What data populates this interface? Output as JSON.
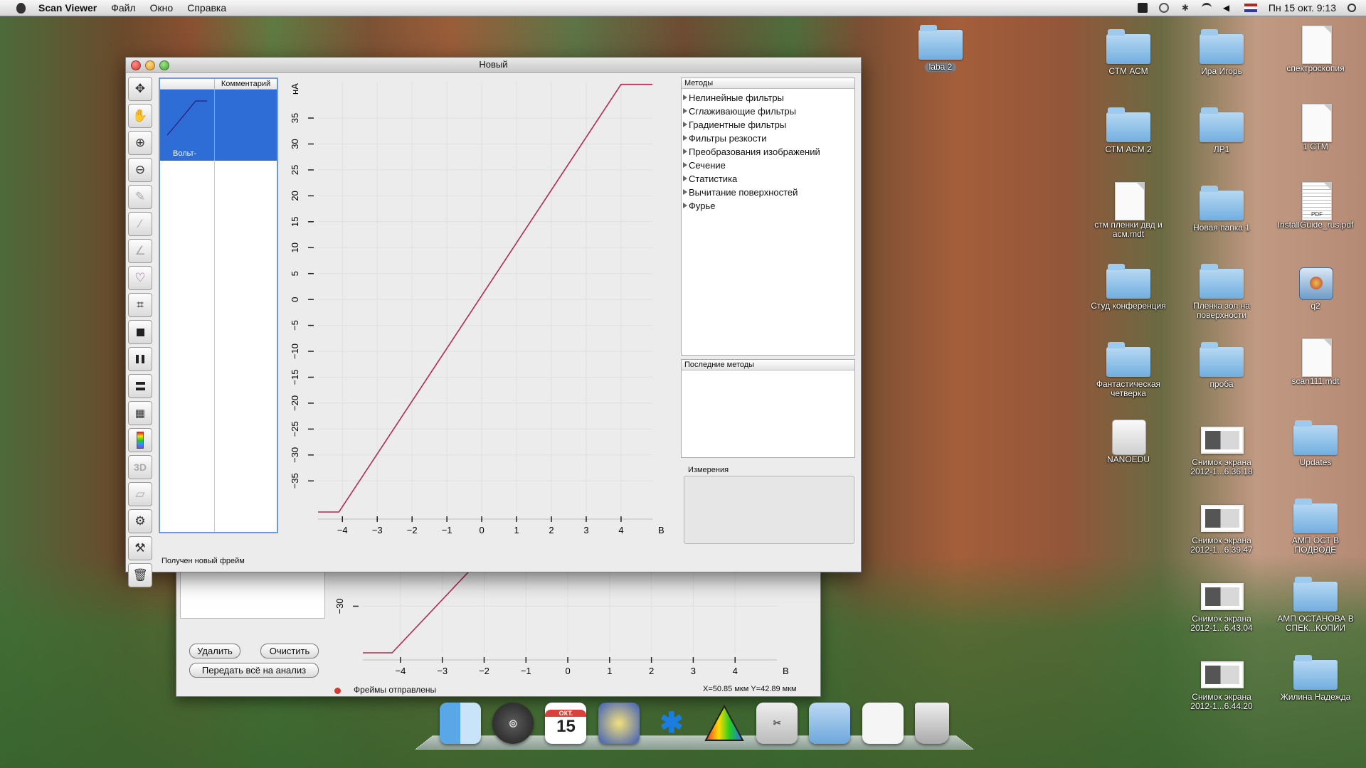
{
  "menubar": {
    "app_name": "Scan Viewer",
    "menus": [
      "Файл",
      "Окно",
      "Справка"
    ],
    "clock": "Пн 15 окт.  9:13"
  },
  "desktop": {
    "icons": [
      {
        "label": "laba 2",
        "kind": "folder"
      },
      {
        "label": "СТМ АСМ",
        "kind": "folder"
      },
      {
        "label": "Ира Игорь",
        "kind": "folder"
      },
      {
        "label": "спектроскопия",
        "kind": "doc"
      },
      {
        "label": "СТМ АСМ  2",
        "kind": "folder"
      },
      {
        "label": "ЛР1",
        "kind": "folder"
      },
      {
        "label": "1 СТМ",
        "kind": "doc"
      },
      {
        "label": "стм пленки двд и асм.mdt",
        "kind": "doc"
      },
      {
        "label": "Новая папка 1",
        "kind": "folder"
      },
      {
        "label": "InstallGuide_rus.pdf",
        "kind": "pdf"
      },
      {
        "label": "Студ конференция",
        "kind": "folder"
      },
      {
        "label": "Пленка зол на поверхности",
        "kind": "folder"
      },
      {
        "label": "q2",
        "kind": "app"
      },
      {
        "label": "Фантастическая четверка",
        "kind": "folder"
      },
      {
        "label": "проба",
        "kind": "folder"
      },
      {
        "label": "scan111.mdt",
        "kind": "doc"
      },
      {
        "label": "NANOEDU",
        "kind": "drive"
      },
      {
        "label": "Снимок экрана 2012-1...6.36.18",
        "kind": "shot"
      },
      {
        "label": "Updates",
        "kind": "folder"
      },
      {
        "label": "Снимок экрана 2012-1...6.39.47",
        "kind": "shot"
      },
      {
        "label": "АМП ОСТ В ПОДВОДЕ",
        "kind": "folder"
      },
      {
        "label": "Снимок экрана 2012-1...6.43.04",
        "kind": "shot"
      },
      {
        "label": "АМП ОСТАНОВА В СПЕК...КОПИИ",
        "kind": "folder"
      },
      {
        "label": "Снимок экрана 2012-1...6.44.20",
        "kind": "shot"
      },
      {
        "label": "Жилина Надежда",
        "kind": "folder"
      }
    ]
  },
  "main_window": {
    "title": "Новый",
    "tools": [
      "move-icon",
      "hand-icon",
      "zoom-in-icon",
      "zoom-out-icon",
      "eyedropper-icon",
      "ruler-icon",
      "angle-icon",
      "heart-icon",
      "crop-icon",
      "stop-icon",
      "pause-icon",
      "single-row-icon",
      "grid-icon",
      "palette-icon",
      "3d-icon",
      "surface-icon",
      "settings-icon",
      "wrench-icon",
      "trash-icon"
    ],
    "tool_3d_label": "3D",
    "frames": {
      "col_comment": "Комментарий",
      "item_label": "Вольт-"
    },
    "status": "Получен новый фрейм",
    "methods": {
      "header": "Методы",
      "items": [
        "Нелинейные фильтры",
        "Сглаживающие фильтры",
        "Градиентные фильтры",
        "Фильтры резкости",
        "Преобразования изображений",
        "Сечение",
        "Статистика",
        "Вычитание поверхностей",
        "Фурье"
      ]
    },
    "recent_header": "Последние методы",
    "measurements_label": "Измерения"
  },
  "back_window": {
    "btn_delete": "Удалить",
    "btn_clear": "Очистить",
    "btn_send_all": "Передать всё на анализ",
    "status": "Фреймы отправлены",
    "coords": "X=50.85 мкм Y=42.89 мкм"
  },
  "dock": {
    "calendar_month": "ОКТ.",
    "calendar_day": "15",
    "items": [
      "finder-icon",
      "dashboard-icon",
      "calendar-icon",
      "mail-icon",
      "bluetooth-icon",
      "prism-icon",
      "scissors-icon",
      "applications-icon",
      "documents-icon",
      "trash-icon"
    ]
  },
  "colors": {
    "trace": "#b02a52",
    "selection": "#2e6dd6"
  },
  "chart_data": [
    {
      "type": "line",
      "title": "",
      "xlabel": "В",
      "ylabel": "нА",
      "xlim": [
        -4.7,
        4.9
      ],
      "ylim": [
        -41,
        42
      ],
      "x_ticks": [
        -4,
        -3,
        -2,
        -1,
        0,
        1,
        2,
        3,
        4
      ],
      "y_ticks": [
        -35,
        -30,
        -25,
        -20,
        -15,
        -10,
        -5,
        0,
        5,
        10,
        15,
        20,
        25,
        30,
        35
      ],
      "grid": true,
      "series": [
        {
          "x": [
            -4.7,
            -4.1,
            4.0,
            4.9
          ],
          "y": [
            -41,
            -41,
            41.5,
            41.5
          ]
        }
      ]
    },
    {
      "type": "line",
      "title": "",
      "xlabel": "В",
      "x_ticks": [
        -4,
        -3,
        -2,
        -1,
        0,
        1,
        2,
        3,
        4
      ],
      "y_ticks": [
        -30
      ],
      "xlim": [
        -4.9,
        5.0
      ],
      "ylim": [
        -41,
        -18
      ],
      "grid": true,
      "series": [
        {
          "x": [
            -4.9,
            -4.2,
            -2.0
          ],
          "y": [
            -41,
            -41,
            -18
          ]
        }
      ]
    }
  ]
}
